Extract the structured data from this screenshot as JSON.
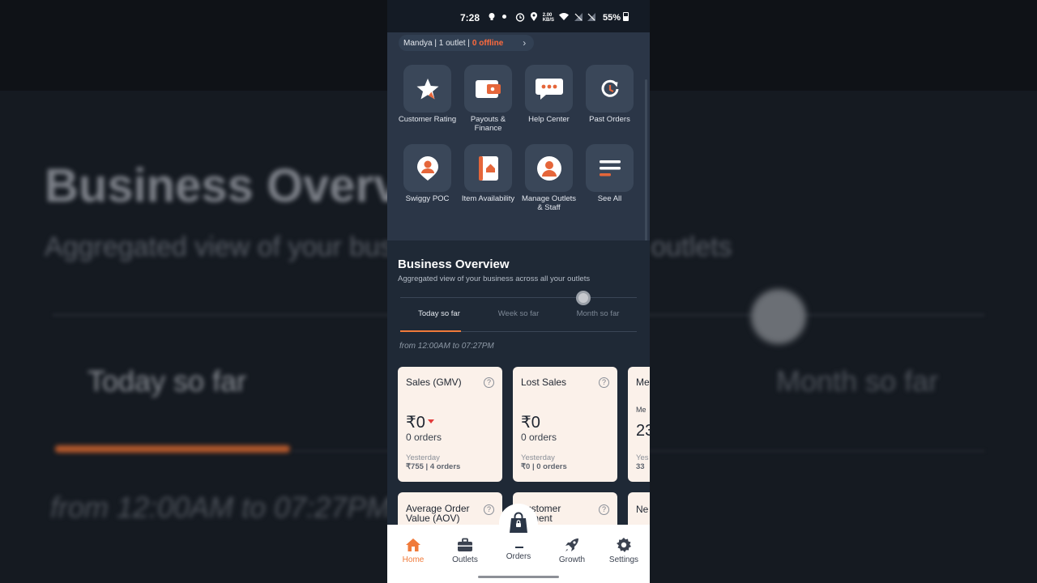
{
  "status_bar": {
    "time": "7:28",
    "speed": "2.00 KB/S",
    "battery": "55%"
  },
  "outlet_bar": {
    "text": "Mandya | 1 outlet |",
    "offline": "0 offline"
  },
  "quick_actions": [
    {
      "label": "Customer Rating",
      "icon": "star-icon"
    },
    {
      "label": "Payouts & Finance",
      "icon": "wallet-icon"
    },
    {
      "label": "Help Center",
      "icon": "chat-bubble-icon"
    },
    {
      "label": "Past Orders",
      "icon": "history-icon"
    },
    {
      "label": "Swiggy POC",
      "icon": "person-pin-icon"
    },
    {
      "label": "Item Availability",
      "icon": "menu-book-icon"
    },
    {
      "label": "Manage Outlets & Staff",
      "icon": "person-icon"
    },
    {
      "label": "See All",
      "icon": "list-icon"
    }
  ],
  "overview": {
    "title": "Business Overview",
    "subtitle": "Aggregated view of your business across all your outlets",
    "tabs": [
      "Today so far",
      "Week so far",
      "Month so far"
    ],
    "active_tab": 0,
    "range": "from 12:00AM to 07:27PM"
  },
  "cards": [
    {
      "title": "Sales (GMV)",
      "value": "₹0",
      "orders": "0 orders",
      "yesterday_label": "Yesterday",
      "yesterday_value": "₹755 | 4 orders",
      "trend": "down"
    },
    {
      "title": "Lost Sales",
      "value": "₹0",
      "orders": "0 orders",
      "yesterday_label": "Yesterday",
      "yesterday_value": "₹0 | 0 orders"
    },
    {
      "title": "Me",
      "value": "23",
      "sub": "Me",
      "yesterday_label": "Yes",
      "yesterday_value": "33"
    },
    {
      "title": "Average Order Value (AOV)"
    },
    {
      "title": "Customer Sentiment",
      "visible_text": "ustomer\ntiment"
    },
    {
      "title": "Ne"
    }
  ],
  "bottom_nav": [
    {
      "label": "Home",
      "active": true,
      "icon": "home-icon"
    },
    {
      "label": "Outlets",
      "icon": "briefcase-icon"
    },
    {
      "label": "Orders",
      "icon": "bag-lock-icon"
    },
    {
      "label": "Growth",
      "icon": "rocket-icon"
    },
    {
      "label": "Settings",
      "icon": "gear-icon"
    }
  ],
  "colors": {
    "accent": "#f07a3a",
    "offline": "#ff6a3d",
    "card": "#fbf1ea",
    "panel": "#2b3647"
  }
}
